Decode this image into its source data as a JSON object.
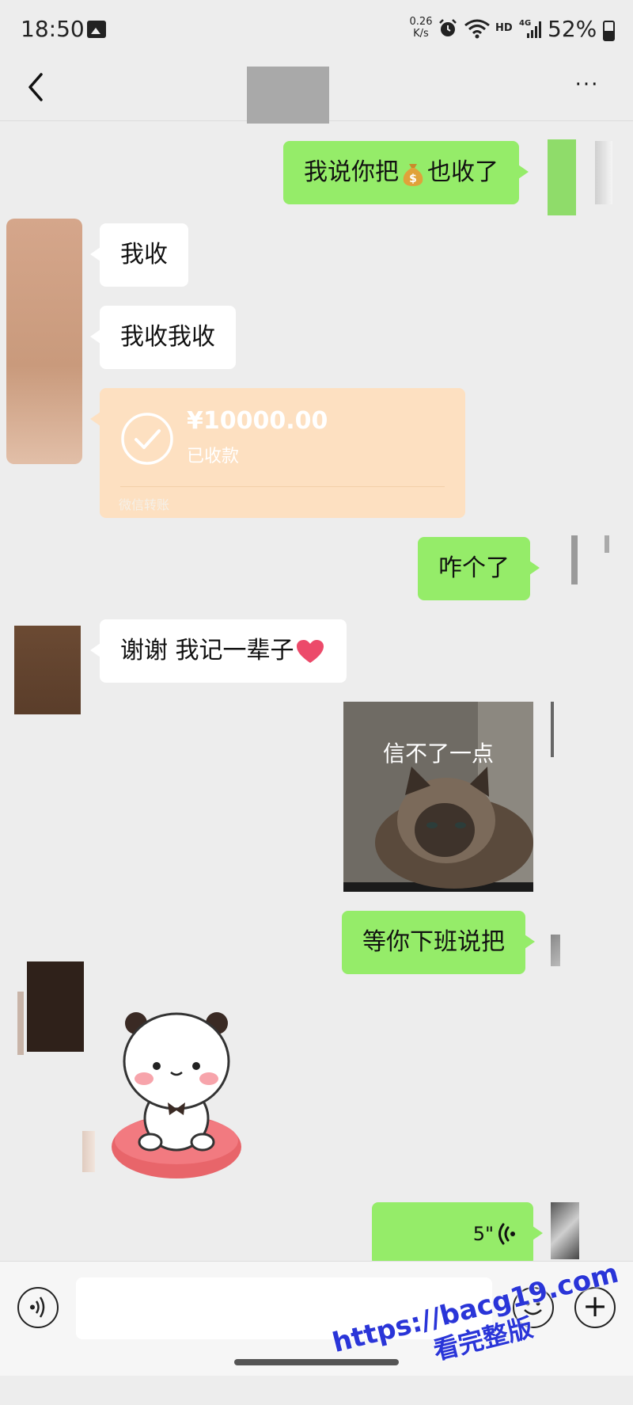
{
  "status_bar": {
    "time": "18:50",
    "net_speed_value": "0.26",
    "net_speed_unit": "K/s",
    "hd": "HD",
    "network": "4G",
    "battery": "52%",
    "battery_level": 0.52
  },
  "header": {
    "title": "",
    "back_icon": "chevron-left-icon",
    "more_icon": "more-dots-icon",
    "more_label": "···"
  },
  "messages": {
    "m1": {
      "text_before": "我说你把",
      "text_after": "也收了",
      "emoji": "money-bag-icon"
    },
    "m2": {
      "text": "我收"
    },
    "m3": {
      "text": "我收我收"
    },
    "transfer": {
      "amount": "¥10000.00",
      "status": "已收款",
      "label": "微信转账"
    },
    "m5": {
      "text": "咋个了"
    },
    "m6": {
      "text": "谢谢 我记一辈子",
      "emoji": "heart-icon"
    },
    "m7": {
      "caption": "信不了一点"
    },
    "m8": {
      "text": "等你下班说把"
    },
    "m9": {
      "sticker": "panda-bear-sticker"
    },
    "m10": {
      "duration": "5\""
    }
  },
  "input_bar": {
    "placeholder": "",
    "voice_icon": "voice-mode-icon",
    "emoji_icon": "smile-icon",
    "plus_icon": "plus-icon",
    "plus_label": "+"
  },
  "watermark": {
    "url": "https://bacg19.com",
    "text": "看完整版"
  },
  "colors": {
    "background": "#ededed",
    "outgoing_bubble": "#95ec69",
    "incoming_bubble": "#ffffff",
    "transfer_card": "#fde0c1",
    "watermark": "#2a35d8"
  }
}
